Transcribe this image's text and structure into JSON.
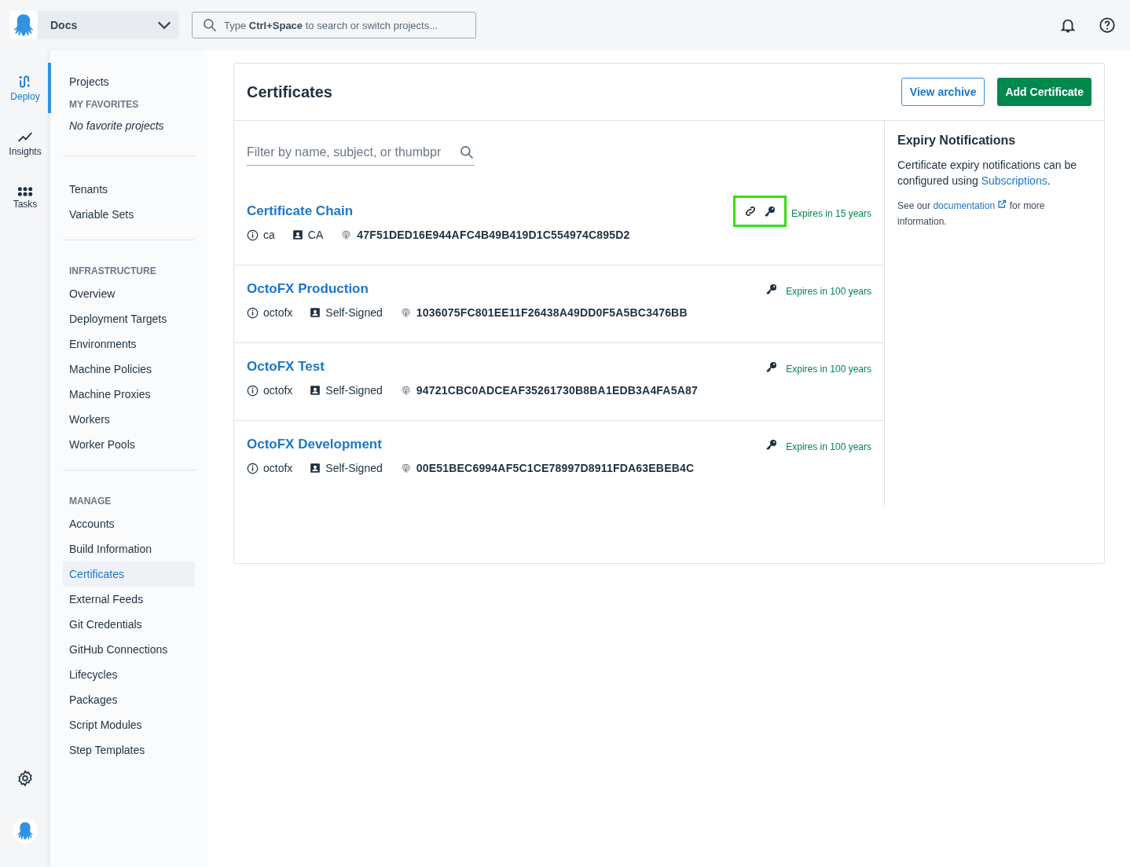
{
  "topbar": {
    "space": "Docs",
    "search": {
      "placeholder": "Type **Ctrl+Space** to search or switch projects..."
    }
  },
  "rail": {
    "items": [
      {
        "label": "Deploy",
        "kind": "deploy",
        "selected": true
      },
      {
        "label": "Insights",
        "kind": "insights",
        "selected": false
      },
      {
        "label": "Tasks",
        "kind": "tasks",
        "selected": false
      }
    ]
  },
  "nav": {
    "sections": [
      {
        "items": [
          {
            "label": "Projects",
            "selected": false
          }
        ],
        "heading": "MY FAVORITES",
        "note": "No favorite projects"
      },
      {
        "items": [
          {
            "label": "Tenants",
            "selected": false
          },
          {
            "label": "Variable Sets",
            "selected": false
          }
        ]
      },
      {
        "heading": "INFRASTRUCTURE",
        "items": [
          {
            "label": "Overview",
            "selected": false
          },
          {
            "label": "Deployment Targets",
            "selected": false
          },
          {
            "label": "Environments",
            "selected": false
          },
          {
            "label": "Machine Policies",
            "selected": false
          },
          {
            "label": "Machine Proxies",
            "selected": false
          },
          {
            "label": "Workers",
            "selected": false
          },
          {
            "label": "Worker Pools",
            "selected": false
          }
        ]
      },
      {
        "heading": "MANAGE",
        "items": [
          {
            "label": "Accounts",
            "selected": false
          },
          {
            "label": "Build Information",
            "selected": false
          },
          {
            "label": "Certificates",
            "selected": true
          },
          {
            "label": "External Feeds",
            "selected": false
          },
          {
            "label": "Git Credentials",
            "selected": false
          },
          {
            "label": "GitHub Connections",
            "selected": false
          },
          {
            "label": "Lifecycles",
            "selected": false
          },
          {
            "label": "Packages",
            "selected": false
          },
          {
            "label": "Script Modules",
            "selected": false
          },
          {
            "label": "Step Templates",
            "selected": false
          }
        ]
      }
    ]
  },
  "page": {
    "title": "Certificates",
    "buttons": [
      {
        "label": "View archive",
        "kind": "secondary"
      },
      {
        "label": "Add Certificate",
        "kind": "primary"
      }
    ],
    "filter": {
      "placeholder": "Filter by name, subject, or thumbpr"
    },
    "certificates": [
      {
        "name": "Certificate Chain",
        "type": "ca",
        "issuer": "CA",
        "thumbprint": "47F51DED16E944AFC4B49B419D1C554974C895D2",
        "chain": true,
        "private_key": true,
        "highlighted": true,
        "expiry": "Expires in 15 years"
      },
      {
        "name": "OctoFX Production",
        "type": "octofx",
        "issuer": "Self-Signed",
        "thumbprint": "1036075FC801EE11F26438A49DD0F5A5BC3476BB",
        "chain": false,
        "private_key": true,
        "highlighted": false,
        "expiry": "Expires in 100 years"
      },
      {
        "name": "OctoFX Test",
        "type": "octofx",
        "issuer": "Self-Signed",
        "thumbprint": "94721CBC0ADCEAF35261730B8BA1EDB3A4FA5A87",
        "chain": false,
        "private_key": true,
        "highlighted": false,
        "expiry": "Expires in 100 years"
      },
      {
        "name": "OctoFX Development",
        "type": "octofx",
        "issuer": "Self-Signed",
        "thumbprint": "00E51BEC6994AF5C1CE78997D8911FDA63EBEB4C",
        "chain": false,
        "private_key": true,
        "highlighted": false,
        "expiry": "Expires in 100 years"
      }
    ],
    "aside": {
      "title": "Expiry Notifications",
      "text_before": "Certificate expiry notifications can be configured using ",
      "link": "Subscriptions",
      "text_after": ".",
      "note_before": "See our ",
      "note_link": "documentation",
      "note_after": " for more information."
    }
  }
}
